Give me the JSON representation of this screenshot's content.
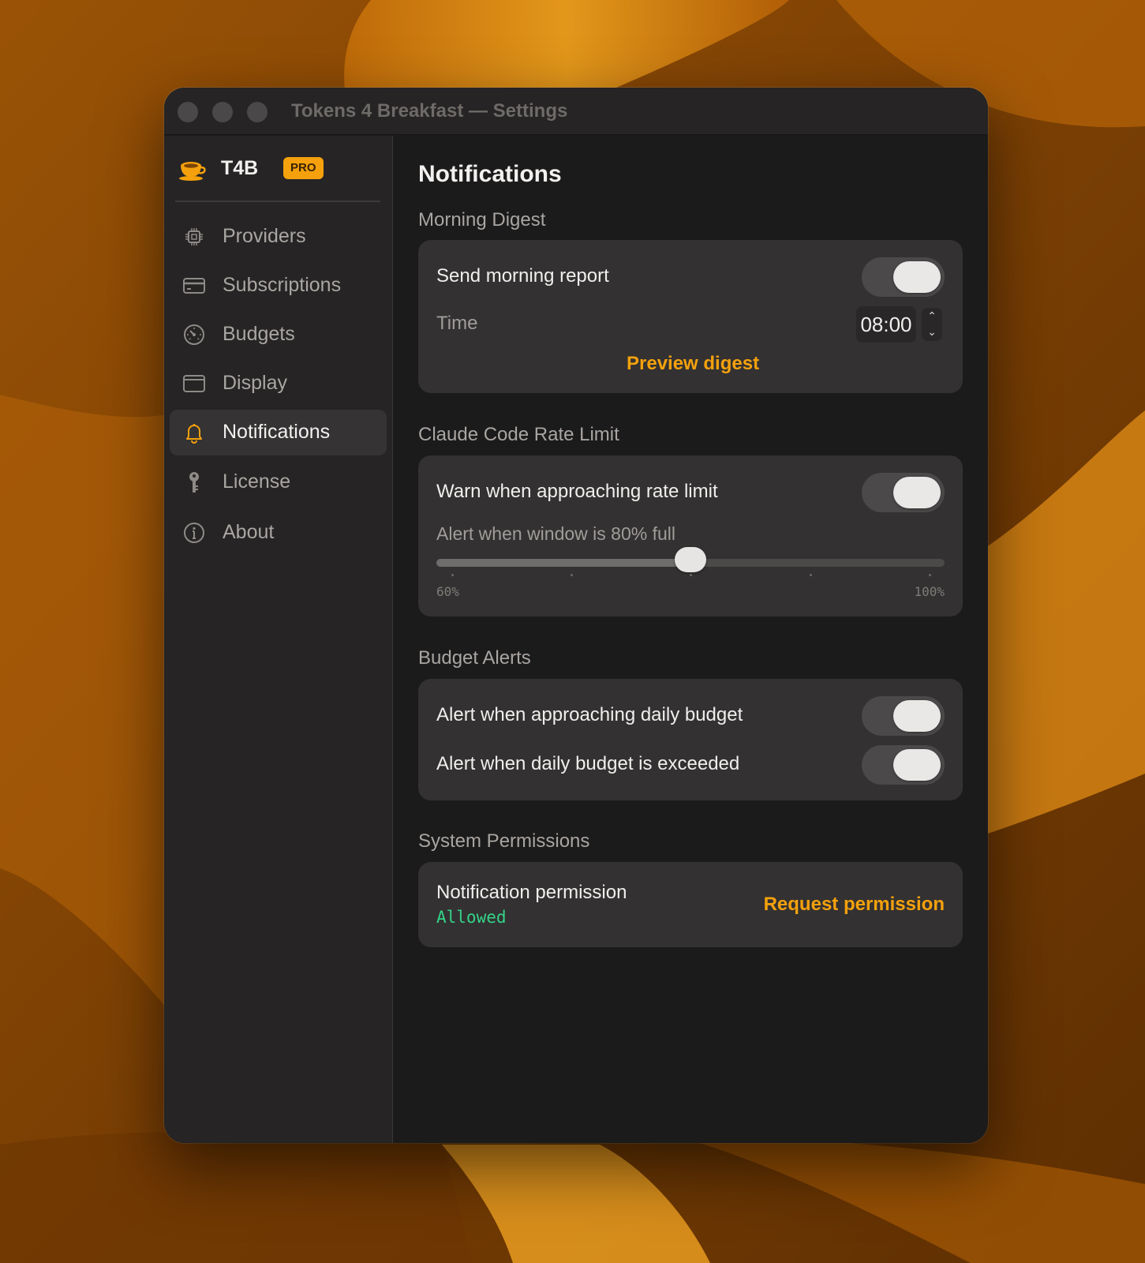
{
  "window": {
    "title": "Tokens 4 Breakfast — Settings"
  },
  "sidebar": {
    "brand": {
      "name": "T4B",
      "badge": "PRO",
      "icon": "coffee-cup-icon"
    },
    "items": [
      {
        "label": "Providers",
        "icon": "chip-icon",
        "active": false
      },
      {
        "label": "Subscriptions",
        "icon": "credit-card-icon",
        "active": false
      },
      {
        "label": "Budgets",
        "icon": "gauge-icon",
        "active": false
      },
      {
        "label": "Display",
        "icon": "window-icon",
        "active": false
      },
      {
        "label": "Notifications",
        "icon": "bell-icon",
        "active": true
      },
      {
        "label": "License",
        "icon": "key-icon",
        "active": false
      },
      {
        "label": "About",
        "icon": "info-icon",
        "active": false
      }
    ]
  },
  "main": {
    "title": "Notifications",
    "morning_digest": {
      "section_title": "Morning Digest",
      "send_report_label": "Send morning report",
      "send_report_enabled": true,
      "time_label": "Time",
      "time_value": "08:00",
      "preview_label": "Preview digest"
    },
    "rate_limit": {
      "section_title": "Claude Code Rate Limit",
      "warn_label": "Warn when approaching rate limit",
      "warn_enabled": true,
      "threshold_label": "Alert when window is 80% full",
      "threshold_value": 80,
      "slider_min": 60,
      "slider_max": 100,
      "min_label": "60%",
      "max_label": "100%"
    },
    "budget_alerts": {
      "section_title": "Budget Alerts",
      "approaching_label": "Alert when approaching daily budget",
      "approaching_enabled": true,
      "exceeded_label": "Alert when daily budget is exceeded",
      "exceeded_enabled": true
    },
    "permissions": {
      "section_title": "System Permissions",
      "permission_label": "Notification permission",
      "status": "Allowed",
      "request_label": "Request permission"
    }
  },
  "colors": {
    "accent": "#f4a10d",
    "allowed": "#34d489",
    "window_bg": "#1c1b1b",
    "sidebar_bg": "#262424",
    "card_bg": "#333131"
  }
}
